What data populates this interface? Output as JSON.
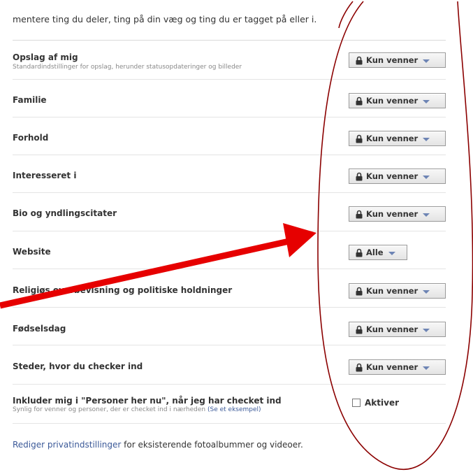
{
  "intro_text": "mentere ting du deler, ting på din væg og ting du er tagget på eller i.",
  "rows": [
    {
      "label": "Opslag af mig",
      "sublabel": "Standardindstillinger for opslag, herunder statusopdateringer og billeder",
      "setting": "Kun venner"
    },
    {
      "label": "Familie",
      "setting": "Kun venner"
    },
    {
      "label": "Forhold",
      "setting": "Kun venner"
    },
    {
      "label": "Interesseret i",
      "setting": "Kun venner"
    },
    {
      "label": "Bio og yndlingscitater",
      "setting": "Kun venner"
    },
    {
      "label": "Website",
      "setting": "Alle"
    },
    {
      "label": "Religiøs overbevisning og politiske holdninger",
      "setting": "Kun venner"
    },
    {
      "label": "Fødselsdag",
      "setting": "Kun venner"
    },
    {
      "label": "Steder, hvor du checker ind",
      "setting": "Kun venner"
    }
  ],
  "places_row": {
    "label": "Inkluder mig i \"Personer her nu\", når jeg har checket ind",
    "sublabel": "Synlig for venner og personer, der er checket ind i nærheden",
    "example_link": "(Se et eksempel)",
    "checkbox_label": "Aktiver",
    "checked": false
  },
  "footer": {
    "link_text": "Rediger privatindstillinger",
    "rest_text": " for eksisterende fotoalbummer og videoer."
  },
  "icons": {
    "lock": "lock-icon",
    "caret": "chevron-down-icon"
  },
  "colors": {
    "link": "#3b5998",
    "annotation": "#e60000",
    "ellipse": "#8b0000"
  }
}
